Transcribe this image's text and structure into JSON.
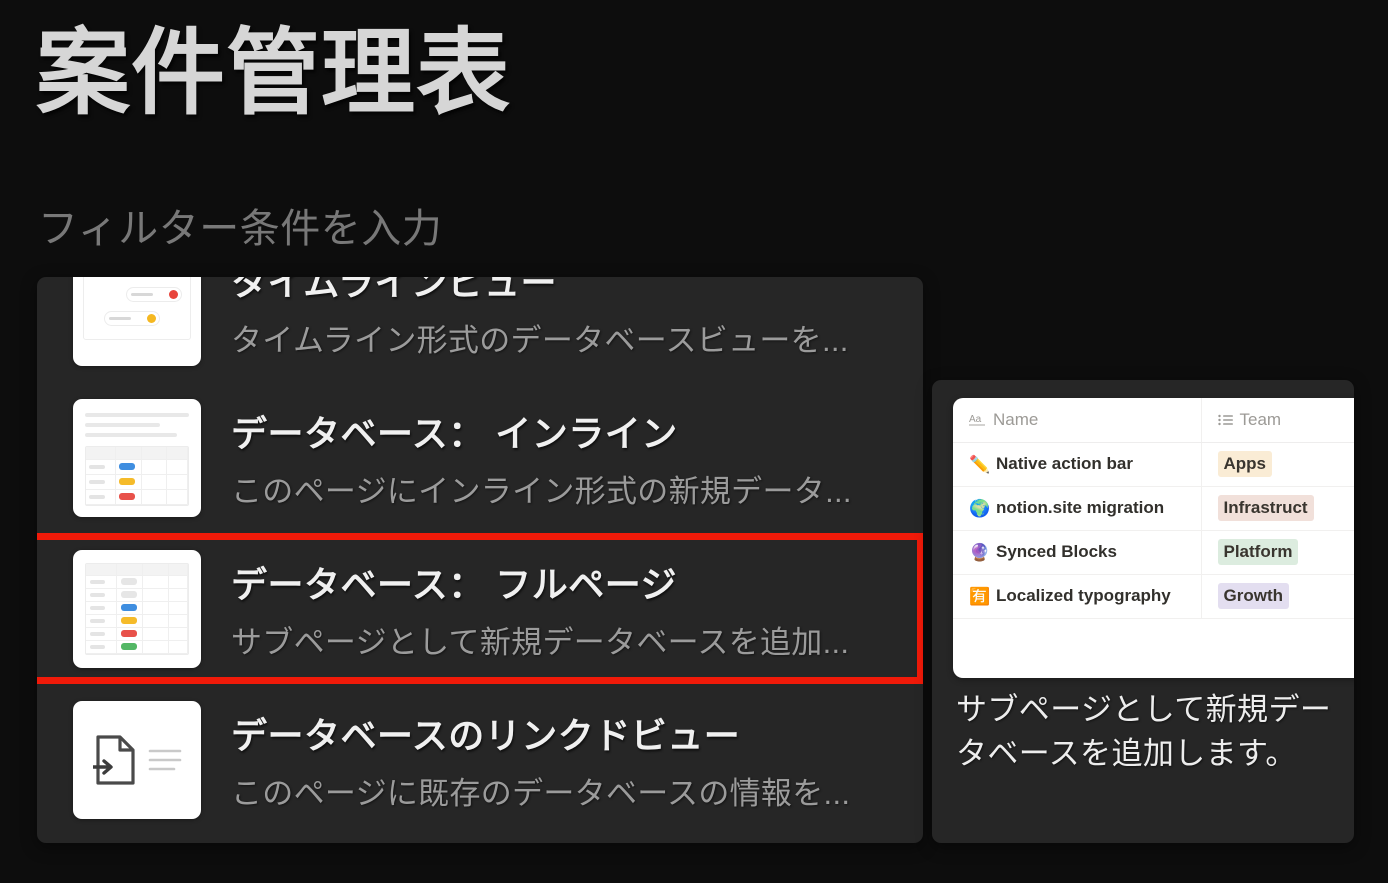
{
  "header": {
    "title": "案件管理表",
    "filter_placeholder": "フィルター条件を入力"
  },
  "list": {
    "items": [
      {
        "icon": "timeline-view-thumbnail",
        "title": "タイムラインビュー",
        "desc": "タイムライン形式のデータベースビューを...",
        "selected": false
      },
      {
        "icon": "database-inline-thumbnail",
        "title": "データベース： インライン",
        "desc": "このページにインライン形式の新規データ...",
        "selected": false
      },
      {
        "icon": "database-fullpage-thumbnail",
        "title": "データベース： フルページ",
        "desc": "サブページとして新規データベースを追加...",
        "selected": true
      },
      {
        "icon": "database-linked-view-thumbnail",
        "title": "データベースのリンクドビュー",
        "desc": "このページに既存のデータベースの情報を...",
        "selected": false
      }
    ]
  },
  "preview": {
    "table": {
      "columns": [
        {
          "icon": "title-property-icon",
          "label": "Name"
        },
        {
          "icon": "multi-select-property-icon",
          "label": "Team"
        }
      ],
      "rows": [
        {
          "emoji": "✏️",
          "name": "Native action bar",
          "team": "Apps",
          "team_color": "#faecd5"
        },
        {
          "emoji": "🌍",
          "name": "notion.site migration",
          "team": "Infrastruct",
          "team_color": "#f1e0da"
        },
        {
          "emoji": "🔮",
          "name": "Synced Blocks",
          "team": "Platform",
          "team_color": "#dcecdf"
        },
        {
          "emoji": "🈶",
          "name": "Localized typography",
          "team": "Growth",
          "team_color": "#e3def0"
        }
      ]
    },
    "description": "サブページとして新規データベースを追加します。"
  },
  "colors": {
    "page_background": "#0d0d0d",
    "panel_background": "#262626",
    "selection_border": "#f01a09",
    "title_text": "#d6d6d6",
    "placeholder_text": "#787878",
    "item_title_text": "#f0f0f0",
    "item_desc_text": "#9b9b9b"
  }
}
